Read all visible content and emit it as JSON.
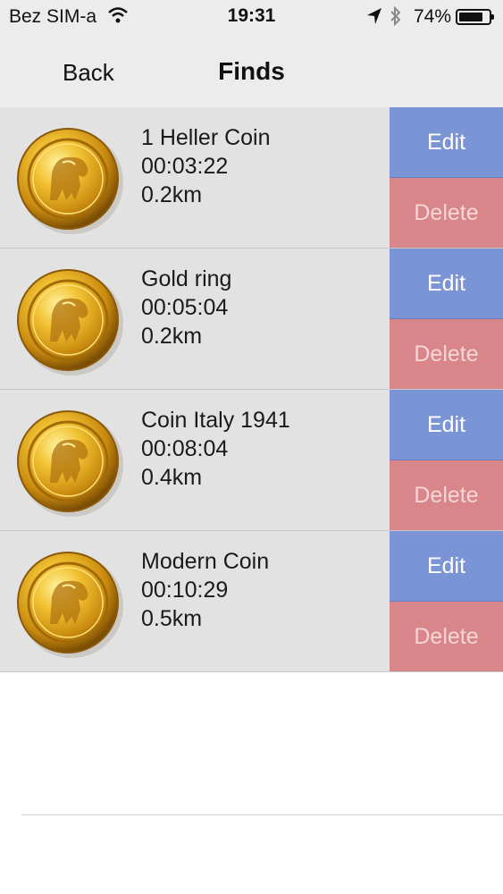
{
  "status_bar": {
    "carrier": "Bez SIM-a",
    "time": "19:31",
    "battery_percent": "74%",
    "icons": [
      "wifi-icon",
      "location-arrow-icon",
      "bluetooth-icon",
      "battery-icon"
    ]
  },
  "nav": {
    "back_label": "Back",
    "title": "Finds"
  },
  "finds": [
    {
      "name": "1 Heller Coin",
      "time": "00:03:22",
      "distance": "0.2km",
      "edit_label": "Edit",
      "delete_label": "Delete"
    },
    {
      "name": "Gold ring",
      "time": "00:05:04",
      "distance": "0.2km",
      "edit_label": "Edit",
      "delete_label": "Delete"
    },
    {
      "name": "Coin Italy 1941",
      "time": "00:08:04",
      "distance": "0.4km",
      "edit_label": "Edit",
      "delete_label": "Delete"
    },
    {
      "name": "Modern Coin",
      "time": "00:10:29",
      "distance": "0.5km",
      "edit_label": "Edit",
      "delete_label": "Delete"
    }
  ],
  "colors": {
    "edit": "#7b94d6",
    "delete": "#d9868a",
    "row_bg": "#e2e2e2",
    "coin_gold": "#e3a91c"
  }
}
